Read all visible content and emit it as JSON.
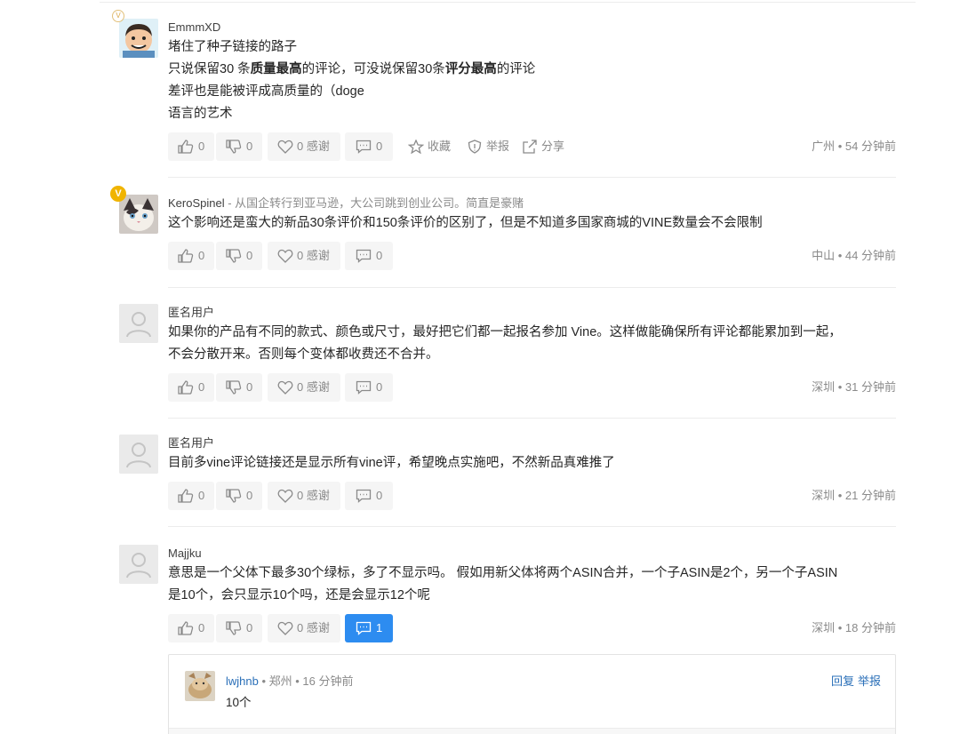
{
  "comments": [
    {
      "author": "EmmmXD",
      "bio": "",
      "lines": [
        [
          {
            "t": "堵住了种子链接的路子"
          }
        ],
        [
          {
            "t": "只说保留30 条"
          },
          {
            "t": "质量最高",
            "b": true
          },
          {
            "t": "的评论，可没说保留30条"
          },
          {
            "t": "评分最高",
            "b": true
          },
          {
            "t": "的评论"
          }
        ],
        [
          {
            "t": "差评也是能被评成高质量的（doge"
          }
        ],
        [
          {
            "t": "语言的艺术"
          }
        ]
      ],
      "likes": "0",
      "dislikes": "0",
      "thanks": "0 感谢",
      "replies": "0",
      "favorite": "收藏",
      "report": "举报",
      "share": "分享",
      "meta": "广州 • 54 分钟前"
    },
    {
      "author": "KeroSpinel",
      "bio": " - 从国企转行到亚马逊，大公司跳到创业公司。简直是豪赌",
      "lines": [
        [
          {
            "t": "这个影响还是蛮大的新品30条评价和150条评价的区别了，但是不知道多国家商城的VINE数量会不会限制"
          }
        ]
      ],
      "likes": "0",
      "dislikes": "0",
      "thanks": "0 感谢",
      "replies": "0",
      "meta": "中山 • 44 分钟前"
    },
    {
      "author": "匿名用户",
      "bio": "",
      "lines": [
        [
          {
            "t": "如果你的产品有不同的款式、颜色或尺寸，最好把它们都一起报名参加 Vine。这样做能确保所有评论都能累加到一起，"
          }
        ],
        [
          {
            "t": "不会分散开来。否则每个变体都收费还不合并。"
          }
        ]
      ],
      "likes": "0",
      "dislikes": "0",
      "thanks": "0 感谢",
      "replies": "0",
      "meta": "深圳 • 31 分钟前"
    },
    {
      "author": "匿名用户",
      "bio": "",
      "lines": [
        [
          {
            "t": "目前多vine评论链接还是显示所有vine评，希望晚点实施吧，不然新品真难推了"
          }
        ]
      ],
      "likes": "0",
      "dislikes": "0",
      "thanks": "0 感谢",
      "replies": "0",
      "meta": "深圳 • 21 分钟前"
    },
    {
      "author": "Majjku",
      "bio": "",
      "lines": [
        [
          {
            "t": "意思是一个父体下最多30个绿标，多了不显示吗。 假如用新父体将两个ASIN合并，一个子ASIN是2个，另一个子ASIN"
          }
        ],
        [
          {
            "t": "是10个，会只显示10个吗，还是会显示12个呢"
          }
        ]
      ],
      "likes": "0",
      "dislikes": "0",
      "thanks": "0 感谢",
      "replies": "1",
      "meta": "深圳 • 18 分钟前"
    }
  ],
  "reply": {
    "author": "lwjhnb",
    "meta": " • 郑州 • 16 分钟前",
    "text": "10个",
    "reply_link": "回复",
    "report_link": "举报"
  },
  "colors": {
    "accent": "#2d8cf0",
    "link": "#2a6fb8",
    "muted": "#8a8a8a"
  }
}
